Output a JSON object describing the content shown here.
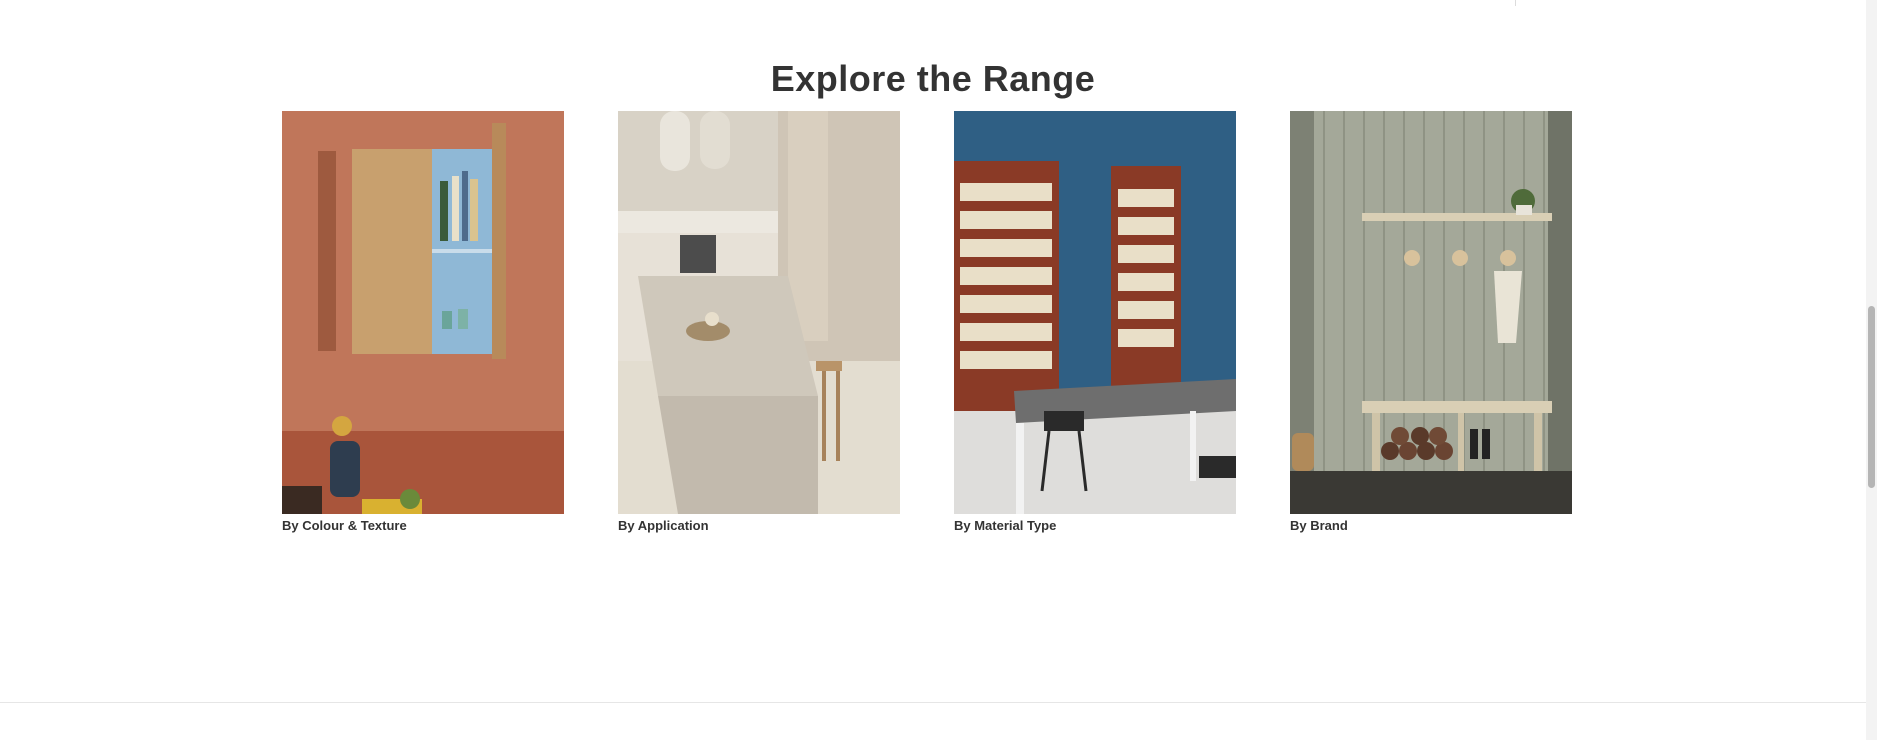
{
  "section": {
    "title": "Explore the Range"
  },
  "cards": [
    {
      "label": "By Colour & Texture",
      "image": "kitchen-cabinet-terracotta-image"
    },
    {
      "label": "By Application",
      "image": "kitchen-island-neutral-image"
    },
    {
      "label": "By Material Type",
      "image": "bookshelf-blue-wall-image"
    },
    {
      "label": "By Brand",
      "image": "entryway-panelled-wall-image"
    }
  ],
  "colors": {
    "heading": "#333333",
    "label": "#333333",
    "divider": "#e6e6e6"
  }
}
